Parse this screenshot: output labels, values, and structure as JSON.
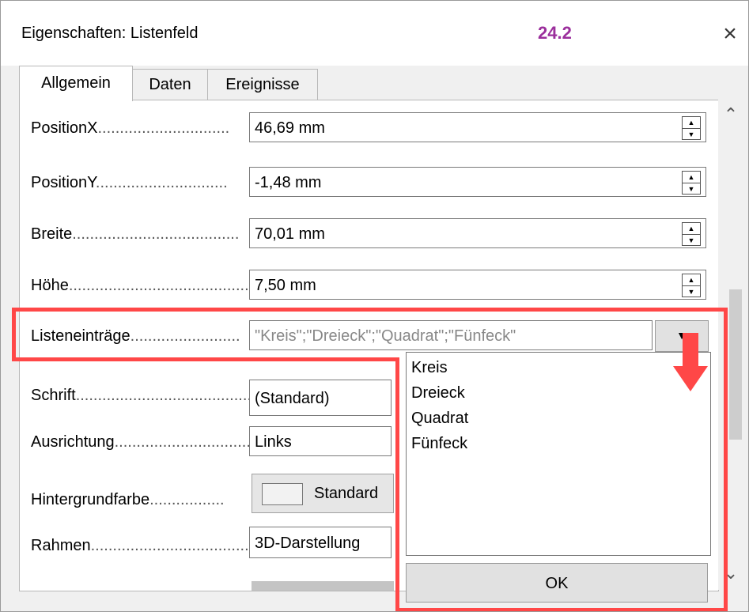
{
  "window": {
    "title": "Eigenschaften: Listenfeld",
    "version": "24.2",
    "close_icon": "×"
  },
  "tabs": [
    {
      "label": "Allgemein"
    },
    {
      "label": "Daten"
    },
    {
      "label": "Ereignisse"
    }
  ],
  "fields": {
    "positionx": {
      "label": "PositionX",
      "value": "46,69 mm"
    },
    "positiony": {
      "label": "PositionY",
      "value": "-1,48 mm"
    },
    "breite": {
      "label": "Breite",
      "value": "70,01 mm"
    },
    "hoehe": {
      "label": "Höhe",
      "value": "7,50 mm"
    },
    "listeneintraege": {
      "label": "Listeneinträge",
      "value": "\"Kreis\";\"Dreieck\";\"Quadrat\";\"Fünfeck\""
    },
    "schrift": {
      "label": "Schrift",
      "value": "(Standard)"
    },
    "ausrichtung": {
      "label": "Ausrichtung",
      "value": "Links"
    },
    "hintergrundfarbe": {
      "label": "Hintergrundfarbe",
      "value": "Standard"
    },
    "rahmen": {
      "label": "Rahmen",
      "value": "3D-Darstellung"
    }
  },
  "dropdown": {
    "items": [
      "Kreis",
      "Dreieck",
      "Quadrat",
      "Fünfeck"
    ],
    "ok_label": "OK"
  },
  "colors": {
    "highlight": "#ff4747",
    "version": "#9b2f9c"
  }
}
